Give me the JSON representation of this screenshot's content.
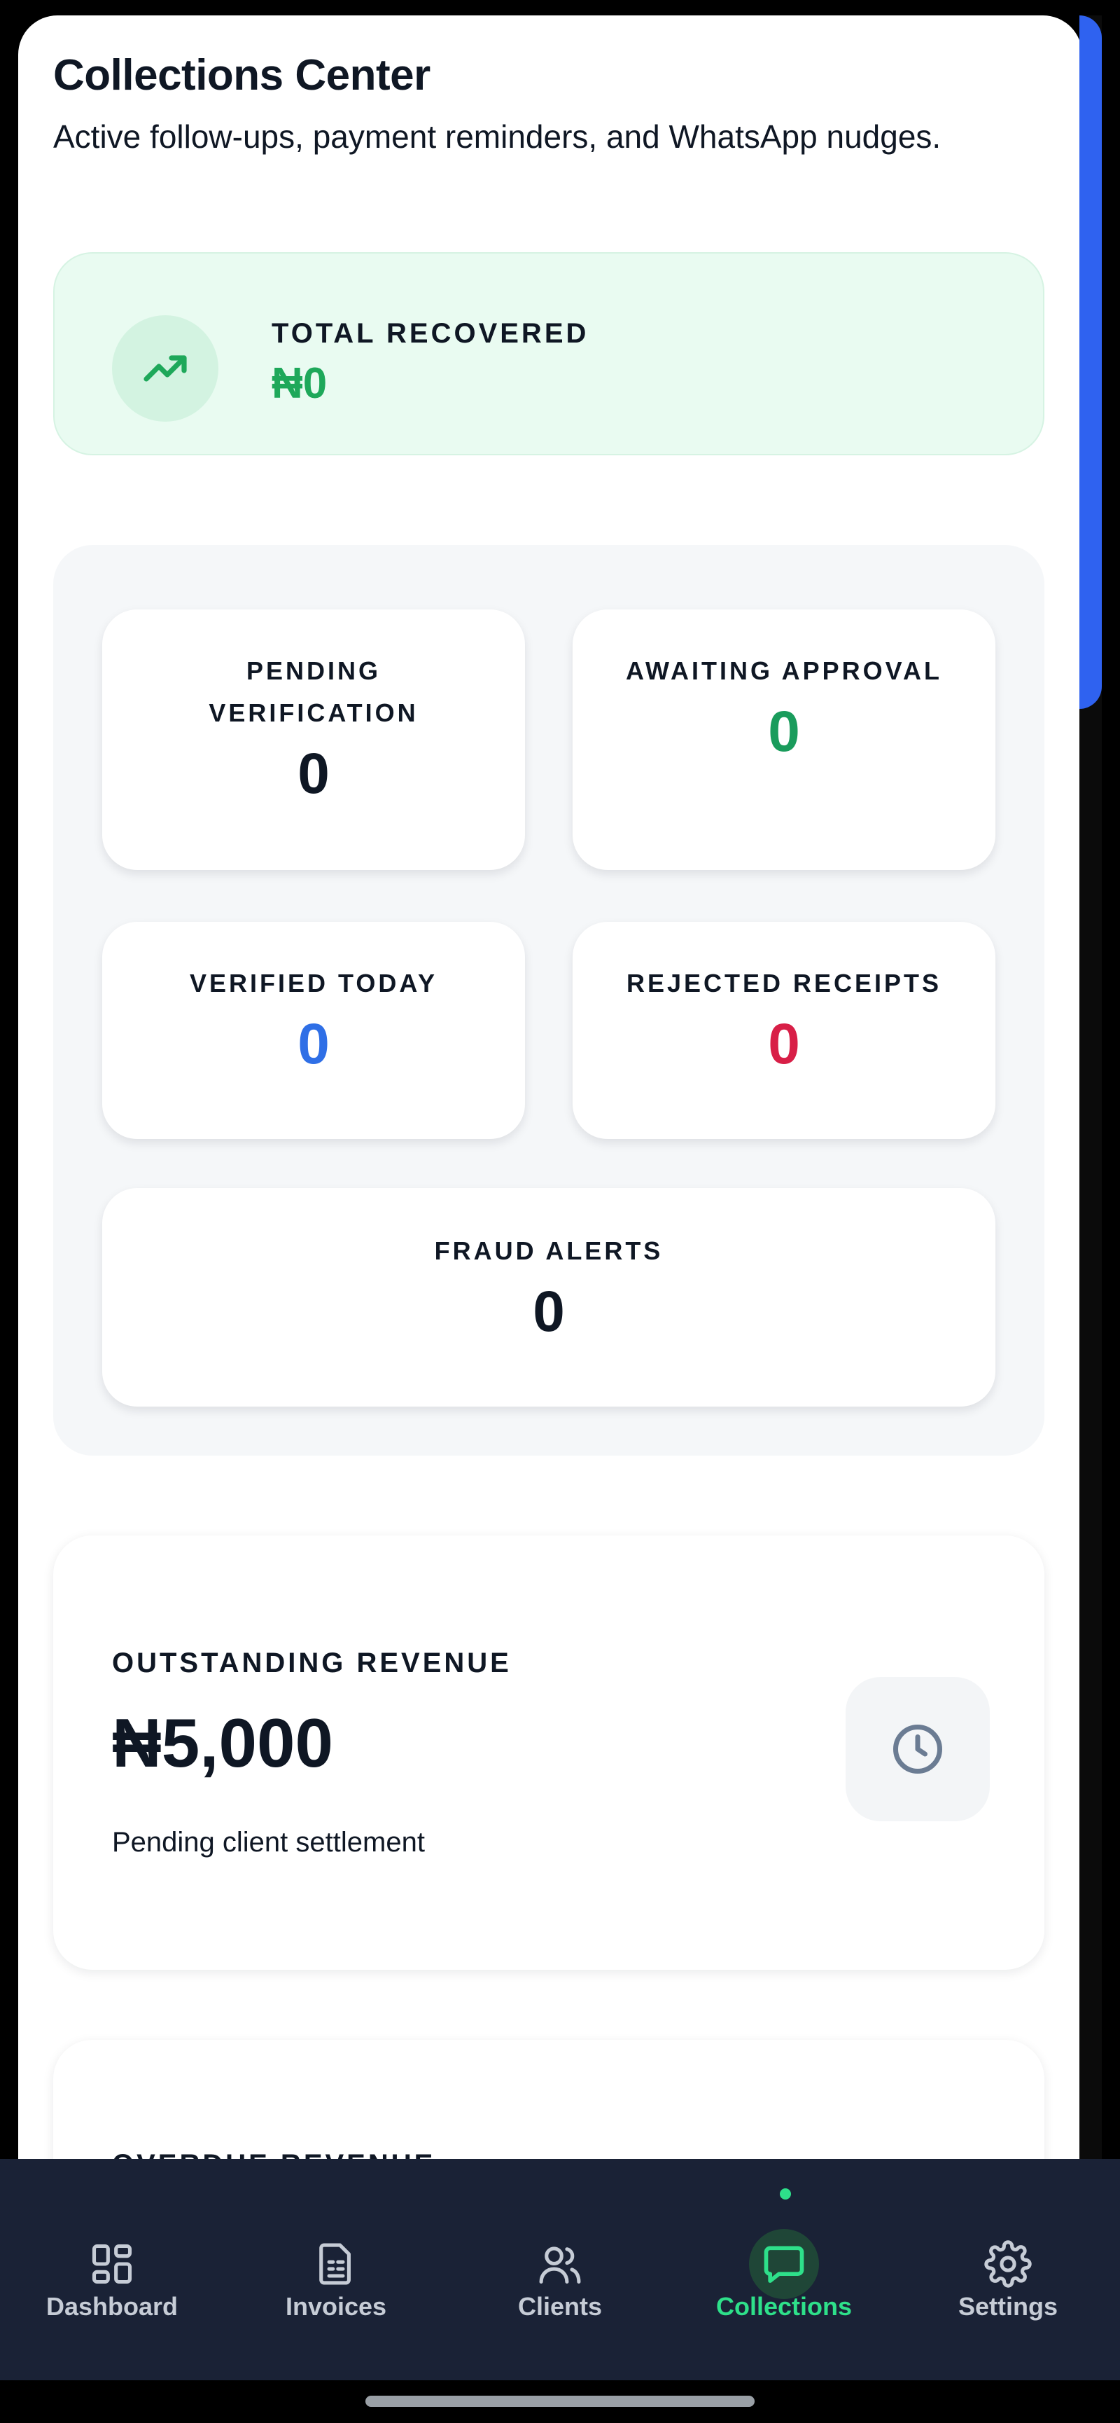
{
  "header": {
    "title": "Collections Center",
    "subtitle": "Active follow-ups, payment reminders, and WhatsApp nudges."
  },
  "recovered": {
    "label": "TOTAL RECOVERED",
    "value": "₦0",
    "icon": "trending-up-icon",
    "color": "#1ea85a"
  },
  "stats": {
    "pending_verification": {
      "label_line1": "PENDING",
      "label_line2": "VERIFICATION",
      "value": "0",
      "color": "#0f1724"
    },
    "awaiting_approval": {
      "label": "AWAITING APPROVAL",
      "value": "0",
      "color": "#1a9c5c"
    },
    "verified_today": {
      "label": "VERIFIED TODAY",
      "value": "0",
      "color": "#2f6fe6"
    },
    "rejected_receipts": {
      "label": "REJECTED RECEIPTS",
      "value": "0",
      "color": "#d81f47"
    },
    "fraud_alerts": {
      "label": "FRAUD ALERTS",
      "value": "0",
      "color": "#0f1724"
    }
  },
  "outstanding": {
    "label": "OUTSTANDING REVENUE",
    "value": "₦5,000",
    "note": "Pending client settlement",
    "icon": "clock-icon"
  },
  "overdue": {
    "label": "OVERDUE REVENUE"
  },
  "nav": {
    "items": [
      {
        "label": "Dashboard",
        "icon": "dashboard-icon",
        "active": false
      },
      {
        "label": "Invoices",
        "icon": "invoice-icon",
        "active": false
      },
      {
        "label": "Clients",
        "icon": "users-icon",
        "active": false
      },
      {
        "label": "Collections",
        "icon": "chat-icon",
        "active": true
      },
      {
        "label": "Settings",
        "icon": "gear-icon",
        "active": false
      }
    ],
    "active_color": "#2ee08a"
  },
  "colors": {
    "accent_blue": "#2f62f0",
    "nav_background": "#1a2236"
  }
}
